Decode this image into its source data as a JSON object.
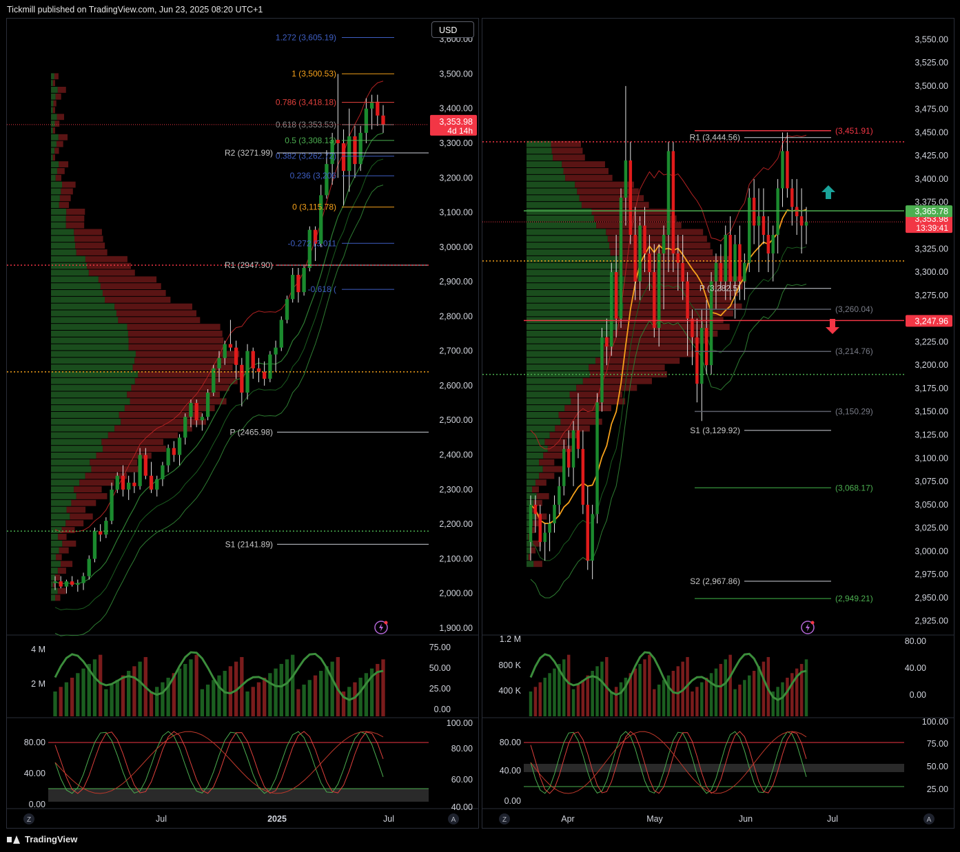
{
  "header": {
    "text": "Tickmill published on TradingView.com, Jun 23, 2025 08:20 UTC+1"
  },
  "footer": {
    "brand": "TradingView"
  },
  "icons": [
    "lightning-icon",
    "arrow-up-icon",
    "arrow-down-icon",
    "tradingview-logo-icon"
  ],
  "colors": {
    "up": "#1b8a2e",
    "down": "#e01b1b",
    "fib_orange": "#f7a21b",
    "fib_blue": "#3f5fc4",
    "price_label": "#f23645",
    "green_label": "#4caf50"
  },
  "chart_data": [
    {
      "type": "candlestick",
      "name": "left-weekly",
      "currency_button": "USD",
      "price_axis": [
        "3,600.00",
        "3,500.00",
        "3,400.00",
        "3,300.00",
        "3,200.00",
        "3,100.00",
        "3,000.00",
        "2,900.00",
        "2,800.00",
        "2,700.00",
        "2,600.00",
        "2,500.00",
        "2,400.00",
        "2,300.00",
        "2,200.00",
        "2,100.00",
        "2,000.00",
        "1,900.00"
      ],
      "ylim": [
        1880,
        3640
      ],
      "time_axis": [
        "Jul",
        "2025",
        "Jul"
      ],
      "current_price": "3,353.98",
      "countdown": "4d 14h",
      "fib_levels": [
        {
          "label": "1.272 (3,605.19)",
          "value": 3605.19,
          "color": "#3f5fc4"
        },
        {
          "label": "1 (3,500.53)",
          "value": 3500.53,
          "color": "#f7a21b"
        },
        {
          "label": "0.786 (3,418.18)",
          "value": 3418.18,
          "color": "#e0403c"
        },
        {
          "label": "0.618 (3,353.53)",
          "value": 3353.53,
          "color": "#8a8a8a"
        },
        {
          "label": "0.5 (3,308.13)",
          "value": 3308.13,
          "color": "#4caf50"
        },
        {
          "label": "0.382 (3,262.72)",
          "value": 3262.72,
          "color": "#3f5fc4"
        },
        {
          "label": "0.236 (3,206",
          "value": 3206,
          "color": "#3f5fc4"
        },
        {
          "label": "0 (3,115.78)",
          "value": 3115.78,
          "color": "#f7a21b"
        },
        {
          "label": "-0.272 (3,011",
          "value": 3011,
          "color": "#3f5fc4"
        },
        {
          "label": "-0.618 (",
          "value": 2878,
          "color": "#3f5fc4"
        }
      ],
      "pivots": [
        {
          "label": "R2 (3271.99)",
          "value": 3271.99
        },
        {
          "label": "R1 (2947.90)",
          "value": 2947.9
        },
        {
          "label": "P (2465.98)",
          "value": 2465.98
        },
        {
          "label": "S1 (2141.89)",
          "value": 2141.89
        }
      ],
      "candles": [
        [
          2030,
          2050,
          2010,
          2035
        ],
        [
          2035,
          2050,
          2015,
          2020
        ],
        [
          2020,
          2040,
          2000,
          2035
        ],
        [
          2035,
          2050,
          2020,
          2025
        ],
        [
          2025,
          2040,
          2005,
          2030
        ],
        [
          2030,
          2060,
          2010,
          2050
        ],
        [
          2050,
          2110,
          2040,
          2100
        ],
        [
          2100,
          2190,
          2090,
          2180
        ],
        [
          2180,
          2200,
          2150,
          2170
        ],
        [
          2170,
          2220,
          2160,
          2210
        ],
        [
          2210,
          2320,
          2200,
          2300
        ],
        [
          2300,
          2350,
          2290,
          2340
        ],
        [
          2340,
          2370,
          2280,
          2300
        ],
        [
          2300,
          2340,
          2270,
          2320
        ],
        [
          2320,
          2350,
          2290,
          2310
        ],
        [
          2310,
          2420,
          2300,
          2400
        ],
        [
          2400,
          2420,
          2330,
          2340
        ],
        [
          2340,
          2380,
          2290,
          2300
        ],
        [
          2300,
          2340,
          2280,
          2330
        ],
        [
          2330,
          2380,
          2310,
          2370
        ],
        [
          2370,
          2430,
          2350,
          2420
        ],
        [
          2420,
          2440,
          2380,
          2400
        ],
        [
          2400,
          2460,
          2370,
          2450
        ],
        [
          2450,
          2520,
          2430,
          2510
        ],
        [
          2510,
          2560,
          2480,
          2550
        ],
        [
          2550,
          2560,
          2480,
          2500
        ],
        [
          2500,
          2520,
          2470,
          2510
        ],
        [
          2510,
          2590,
          2500,
          2580
        ],
        [
          2580,
          2660,
          2570,
          2650
        ],
        [
          2650,
          2700,
          2610,
          2680
        ],
        [
          2680,
          2730,
          2660,
          2720
        ],
        [
          2720,
          2790,
          2700,
          2710
        ],
        [
          2710,
          2730,
          2620,
          2660
        ],
        [
          2660,
          2680,
          2540,
          2580
        ],
        [
          2580,
          2720,
          2560,
          2700
        ],
        [
          2700,
          2710,
          2620,
          2650
        ],
        [
          2650,
          2680,
          2610,
          2640
        ],
        [
          2640,
          2670,
          2600,
          2620
        ],
        [
          2620,
          2700,
          2610,
          2690
        ],
        [
          2690,
          2730,
          2640,
          2710
        ],
        [
          2710,
          2800,
          2700,
          2790
        ],
        [
          2790,
          2860,
          2780,
          2850
        ],
        [
          2850,
          2940,
          2840,
          2920
        ],
        [
          2920,
          2940,
          2840,
          2870
        ],
        [
          2870,
          2950,
          2860,
          2940
        ],
        [
          2940,
          3060,
          2930,
          3050
        ],
        [
          3050,
          3060,
          2960,
          3010
        ],
        [
          3010,
          3180,
          3000,
          3150
        ],
        [
          3150,
          3280,
          3140,
          3240
        ],
        [
          3240,
          3330,
          3180,
          3310
        ],
        [
          3310,
          3500,
          3200,
          3300
        ],
        [
          3300,
          3340,
          3120,
          3220
        ],
        [
          3220,
          3400,
          3160,
          3320
        ],
        [
          3320,
          3350,
          3200,
          3240
        ],
        [
          3240,
          3350,
          3220,
          3330
        ],
        [
          3330,
          3430,
          3300,
          3400
        ],
        [
          3400,
          3440,
          3340,
          3420
        ],
        [
          3420,
          3440,
          3350,
          3380
        ],
        [
          3380,
          3410,
          3330,
          3354
        ]
      ],
      "volume_axis": [
        "4 M",
        "2 M"
      ],
      "rsi_axis": [
        "75.00",
        "50.00",
        "25.00",
        "0.00"
      ],
      "stoch_axis_left": [
        "80.00",
        "40.00",
        "0.00"
      ],
      "stoch_axis_right": [
        "100.00",
        "80.00",
        "60.00",
        "40.00"
      ]
    },
    {
      "type": "candlestick",
      "name": "right-daily",
      "price_axis": [
        "3,550.00",
        "3,525.00",
        "3,500.00",
        "3,475.00",
        "3,450.00",
        "3,425.00",
        "3,400.00",
        "3,375.00",
        "3,350.00",
        "3,325.00",
        "3,300.00",
        "3,275.00",
        "3,250.00",
        "3,225.00",
        "3,200.00",
        "3,175.00",
        "3,150.00",
        "3,125.00",
        "3,100.00",
        "3,075.00",
        "3,050.00",
        "3,025.00",
        "3,000.00",
        "2,975.00",
        "2,950.00",
        "2,925.00"
      ],
      "ylim": [
        2910,
        3565
      ],
      "time_axis": [
        "Apr",
        "May",
        "Jun",
        "Jul"
      ],
      "current_price": "3,353.98",
      "countdown": "13:39:41",
      "green_label": "3,365.78",
      "red_label": "3,247.96",
      "levels": [
        {
          "label": "(3,451.91)",
          "value": 3451.91,
          "color": "#f23645"
        },
        {
          "label": "(3,260.04)",
          "value": 3260.04,
          "color": "#5d606b"
        },
        {
          "label": "(3,214.76)",
          "value": 3214.76,
          "color": "#5d606b"
        },
        {
          "label": "(3,150.29)",
          "value": 3150.29,
          "color": "#5d606b"
        },
        {
          "label": "(3,068.17)",
          "value": 3068.17,
          "color": "#2e7d32"
        },
        {
          "label": "(2,949.21)",
          "value": 2949.21,
          "color": "#2e7d32"
        }
      ],
      "pivots": [
        {
          "label": "R1 (3,444.56)",
          "value": 3444.56
        },
        {
          "label": "P (3,282.5)",
          "value": 3282.5
        },
        {
          "label": "S1 (3,129.92)",
          "value": 3129.92
        },
        {
          "label": "S2 (2,967.86)",
          "value": 2967.86
        }
      ],
      "candles": [
        [
          3010,
          3060,
          2990,
          3050
        ],
        [
          3050,
          3060,
          3020,
          3040
        ],
        [
          3040,
          3050,
          3000,
          3010
        ],
        [
          3010,
          3030,
          2990,
          3020
        ],
        [
          3020,
          3040,
          3000,
          3030
        ],
        [
          3030,
          3060,
          3020,
          3050
        ],
        [
          3050,
          3080,
          3040,
          3070
        ],
        [
          3070,
          3120,
          3060,
          3110
        ],
        [
          3110,
          3130,
          3080,
          3090
        ],
        [
          3090,
          3140,
          3070,
          3130
        ],
        [
          3130,
          3170,
          3100,
          3110
        ],
        [
          3110,
          3130,
          3040,
          3050
        ],
        [
          3050,
          3070,
          2980,
          2990
        ],
        [
          2990,
          3050,
          2970,
          3040
        ],
        [
          3040,
          3170,
          3030,
          3160
        ],
        [
          3160,
          3240,
          3150,
          3230
        ],
        [
          3230,
          3250,
          3200,
          3220
        ],
        [
          3220,
          3310,
          3210,
          3300
        ],
        [
          3300,
          3340,
          3230,
          3250
        ],
        [
          3250,
          3390,
          3240,
          3380
        ],
        [
          3380,
          3500,
          3350,
          3420
        ],
        [
          3420,
          3440,
          3330,
          3340
        ],
        [
          3340,
          3370,
          3270,
          3290
        ],
        [
          3290,
          3360,
          3270,
          3350
        ],
        [
          3350,
          3370,
          3300,
          3320
        ],
        [
          3320,
          3340,
          3280,
          3300
        ],
        [
          3300,
          3330,
          3230,
          3240
        ],
        [
          3240,
          3330,
          3220,
          3320
        ],
        [
          3320,
          3350,
          3260,
          3340
        ],
        [
          3340,
          3440,
          3300,
          3430
        ],
        [
          3430,
          3440,
          3300,
          3320
        ],
        [
          3320,
          3340,
          3280,
          3310
        ],
        [
          3310,
          3340,
          3270,
          3290
        ],
        [
          3290,
          3300,
          3210,
          3250
        ],
        [
          3250,
          3260,
          3200,
          3230
        ],
        [
          3230,
          3250,
          3160,
          3180
        ],
        [
          3180,
          3260,
          3140,
          3240
        ],
        [
          3240,
          3270,
          3190,
          3200
        ],
        [
          3200,
          3300,
          3190,
          3290
        ],
        [
          3290,
          3320,
          3260,
          3310
        ],
        [
          3310,
          3330,
          3280,
          3290
        ],
        [
          3290,
          3350,
          3270,
          3340
        ],
        [
          3340,
          3360,
          3270,
          3290
        ],
        [
          3290,
          3340,
          3250,
          3330
        ],
        [
          3330,
          3350,
          3270,
          3290
        ],
        [
          3290,
          3320,
          3270,
          3310
        ],
        [
          3310,
          3390,
          3300,
          3380
        ],
        [
          3380,
          3400,
          3330,
          3350
        ],
        [
          3350,
          3390,
          3300,
          3360
        ],
        [
          3360,
          3390,
          3330,
          3340
        ],
        [
          3340,
          3360,
          3300,
          3320
        ],
        [
          3320,
          3350,
          3290,
          3340
        ],
        [
          3340,
          3400,
          3320,
          3390
        ],
        [
          3390,
          3450,
          3370,
          3430
        ],
        [
          3430,
          3450,
          3380,
          3390
        ],
        [
          3390,
          3400,
          3350,
          3370
        ],
        [
          3370,
          3400,
          3340,
          3360
        ],
        [
          3360,
          3390,
          3320,
          3350
        ],
        [
          3350,
          3370,
          3330,
          3354
        ]
      ],
      "volume_axis": [
        "1.2 M",
        "800 K",
        "400 K"
      ],
      "rsi_axis": [
        "80.00",
        "40.00",
        "0.00"
      ],
      "stoch_axis_left": [
        "80.00",
        "40.00",
        "0.00"
      ],
      "stoch_axis_right": [
        "100.00",
        "75.00",
        "50.00",
        "25.00"
      ]
    }
  ],
  "scale_buttons": [
    "Z",
    "A"
  ]
}
